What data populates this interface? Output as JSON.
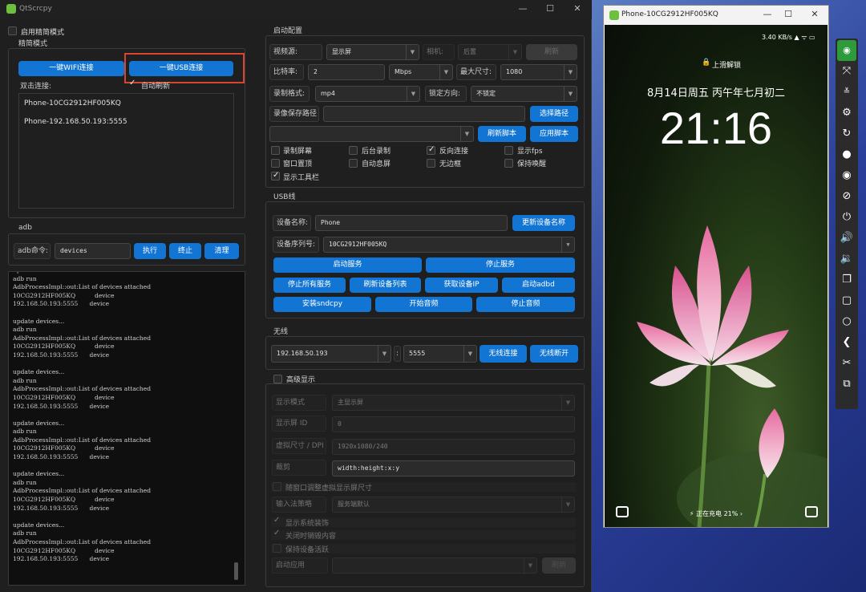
{
  "qt": {
    "title": "QtScrcpy",
    "simple_mode_label": "启用精简模式",
    "simple_group_title": "精简模式",
    "wifi_connect": "一键WIFI连接",
    "usb_connect": "一键USB连接",
    "double_click_label": "双击连接:",
    "auto_refresh": "自动刷新",
    "devices": [
      "Phone-10CG2912HF005KQ",
      "Phone-192.168.50.193:5555"
    ],
    "adb_title": "adb",
    "adb_cmd_label": "adb命令:",
    "adb_cmd_value": "devices",
    "exec": "执行",
    "stop": "终止",
    "clear": "清理",
    "log_lines": [
      "update devices...",
      "adb run",
      "AdbProcessImpl::out:List of devices attached",
      "10CG2912HF005KQ          device",
      "192.168.50.193:5555      device",
      "",
      "update devices...",
      "adb run",
      "AdbProcessImpl::out:List of devices attached",
      "10CG2912HF005KQ          device",
      "192.168.50.193:5555      device",
      "",
      "update devices...",
      "adb run",
      "AdbProcessImpl::out:List of devices attached",
      "10CG2912HF005KQ          device",
      "192.168.50.193:5555      device",
      "",
      "update devices...",
      "adb run",
      "AdbProcessImpl::out:List of devices attached",
      "10CG2912HF005KQ          device",
      "192.168.50.193:5555      device",
      "",
      "update devices...",
      "adb run",
      "AdbProcessImpl::out:List of devices attached",
      "10CG2912HF005KQ          device",
      "192.168.50.193:5555      device",
      "",
      "update devices...",
      "adb run",
      "AdbProcessImpl::out:List of devices attached",
      "10CG2912HF005KQ          device",
      "192.168.50.193:5555      device"
    ],
    "start_config": {
      "title": "启动配置",
      "video_source_label": "视频源:",
      "video_source_value": "显示屏",
      "camera_label": "相机:",
      "camera_value": "后置",
      "refresh": "刷新",
      "bitrate_label": "比特率:",
      "bitrate_value": "2",
      "bitrate_unit": "Mbps",
      "max_size_label": "最大尺寸:",
      "max_size_value": "1080",
      "record_format_label": "录制格式:",
      "record_format_value": "mp4",
      "lock_orientation_label": "锁定方向:",
      "lock_orientation_value": "不锁定",
      "record_path_label": "录像保存路径",
      "select_path": "选择路径",
      "refresh_script": "刷新脚本",
      "apply_script": "应用脚本",
      "options": [
        {
          "label": "录制屏幕",
          "checked": false
        },
        {
          "label": "后台录制",
          "checked": false
        },
        {
          "label": "反向连接",
          "checked": true
        },
        {
          "label": "显示fps",
          "checked": false
        },
        {
          "label": "窗口置顶",
          "checked": false
        },
        {
          "label": "自动息屏",
          "checked": false
        },
        {
          "label": "无边框",
          "checked": false
        },
        {
          "label": "保持唤醒",
          "checked": false
        },
        {
          "label": "显示工具栏",
          "checked": true
        }
      ]
    },
    "usb": {
      "title": "USB线",
      "device_name_label": "设备名称:",
      "device_name_value": "Phone",
      "update_name": "更新设备名称",
      "serial_label": "设备序列号:",
      "serial_value": "10CG2912HF005KQ",
      "start_service": "启动服务",
      "stop_service": "停止服务",
      "stop_all": "停止所有服务",
      "refresh_devices": "刷新设备列表",
      "get_ip": "获取设备IP",
      "start_adbd": "启动adbd",
      "install_sndcpy": "安装sndcpy",
      "start_audio": "开始音频",
      "stop_audio": "停止音频"
    },
    "wireless": {
      "title": "无线",
      "ip_value": "192.168.50.193",
      "port_value": "5555",
      "connect": "无线连接",
      "disconnect": "无线断开"
    },
    "advanced": {
      "title": "高级显示",
      "display_mode_label": "显示模式",
      "display_mode_value": "主显示屏",
      "display_id_label": "显示屏 ID",
      "display_id_value": "0",
      "virtual_size_label": "虚拟尺寸 / DPI",
      "virtual_size_value": "1920x1080/240",
      "crop_label": "裁剪",
      "crop_value": "width:height:x:y",
      "resize_virtual": "随窗口调整虚拟显示屏尺寸",
      "ime_label": "输入法策略",
      "ime_value": "服务端默认",
      "show_decorations": "显示系统装饰",
      "destroy_content": "关闭时销毁内容",
      "keep_awake": "保持设备活跃",
      "launch_app_label": "启动应用",
      "launch_refresh": "刷新"
    }
  },
  "phone": {
    "title": "Phone-10CG2912HF005KQ",
    "status_icons": "3.40 KB/s  ▲  ᯤ  ▭",
    "lock_hint": "上滑解锁",
    "date": "8月14日周五  丙午年七月初二",
    "time": "21:16",
    "charging": "⚡ 正在充电 21% ›",
    "toolbar_icons": [
      "android-icon",
      "fullscreen-icon",
      "collapse-icon",
      "settings-icon",
      "rotate-icon",
      "record-icon",
      "eye-icon",
      "eye-off-icon",
      "power-icon",
      "volume-up-icon",
      "volume-down-icon",
      "app-switch-icon",
      "home-icon",
      "circle-icon",
      "back-icon",
      "scissors-icon",
      "copy-icon"
    ]
  }
}
